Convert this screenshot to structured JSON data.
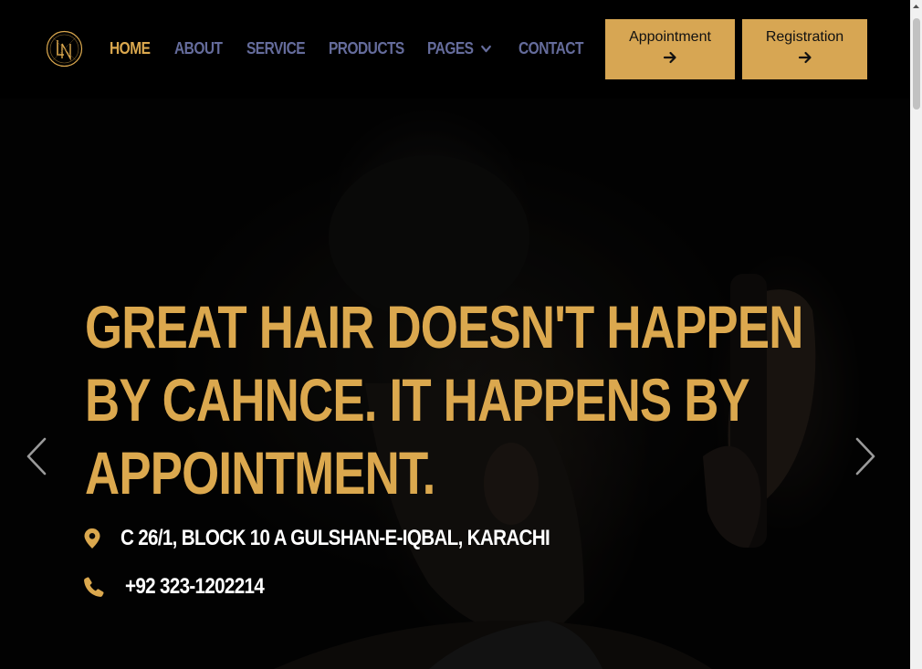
{
  "colors": {
    "accent": "#dba84e",
    "nav_inactive": "#656c9c",
    "button_bg": "#d7a653",
    "background": "#000000"
  },
  "header": {
    "logo_icon": "ln-monogram-logo",
    "nav": [
      {
        "label": "HOME",
        "active": true
      },
      {
        "label": "ABOUT"
      },
      {
        "label": "SERVICE"
      },
      {
        "label": "PRODUCTS"
      },
      {
        "label": "PAGES",
        "has_dropdown": true
      },
      {
        "label": "CONTACT"
      }
    ],
    "buttons": {
      "appointment": {
        "label": "Appointment",
        "icon": "arrow-right-icon"
      },
      "registration": {
        "label": "Registration",
        "icon": "arrow-right-icon"
      }
    }
  },
  "hero": {
    "headline_lines": [
      "GREAT HAIR DOESN'T HAPPEN",
      "BY CAHNCE. IT HAPPENS BY",
      "APPOINTMENT."
    ],
    "address": {
      "icon": "map-pin-icon",
      "text": "C 26/1, BLOCK 10 A GULSHAN-E-IQBAL, KARACHI"
    },
    "phone": {
      "icon": "phone-icon",
      "text": "+92 323-1202214"
    },
    "slider": {
      "prev_icon": "chevron-left-icon",
      "next_icon": "chevron-right-icon"
    }
  }
}
